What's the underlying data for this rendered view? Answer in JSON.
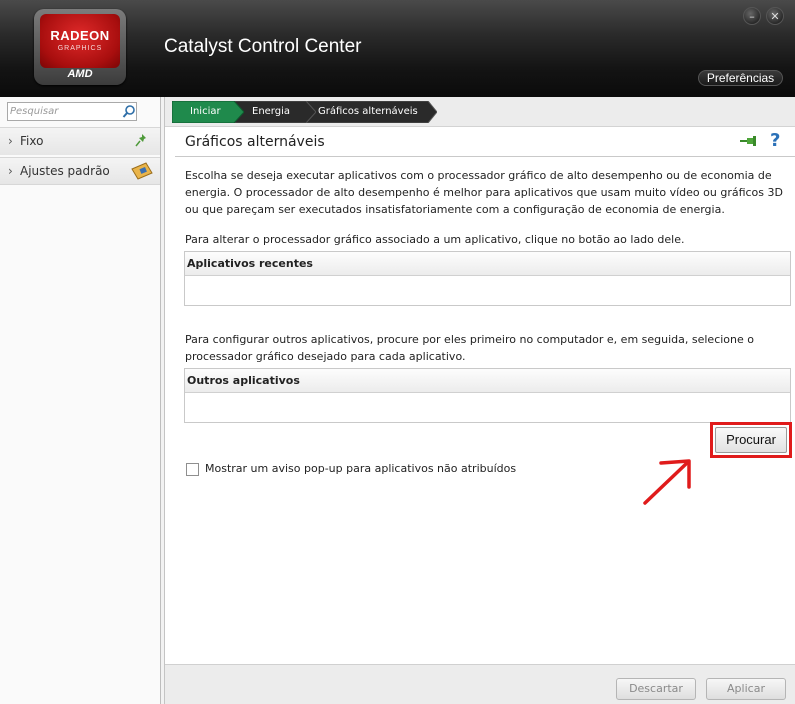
{
  "header": {
    "app_title": "Catalyst Control Center",
    "logo": {
      "line1": "RADEON",
      "line2": "GRAPHICS",
      "brand": "AMD"
    },
    "minimize_icon": "minus-icon",
    "close_icon": "close-icon",
    "minimize_glyph": "–",
    "close_glyph": "✕",
    "preferences_label": "Preferências"
  },
  "sidebar": {
    "search_placeholder": "Pesquisar",
    "search_icon": "search-icon",
    "items": [
      {
        "label": "Fixo",
        "icon": "pin-icon"
      },
      {
        "label": "Ajustes padrão",
        "icon": "card-icon"
      }
    ],
    "chevron": "›"
  },
  "breadcrumb": [
    "Iniciar",
    "Energia",
    "Gráficos alternáveis"
  ],
  "main": {
    "title": "Gráficos alternáveis",
    "help_glyph": "?",
    "description": "Escolha se deseja executar aplicativos com o processador gráfico de alto desempenho ou de economia de energia. O processador de alto desempenho é melhor para aplicativos que usam muito vídeo ou gráficos 3D ou que pareçam ser executados insatisfatoriamente com a configuração de economia de energia.",
    "hint": "Para alterar o processador gráfico associado a um aplicativo, clique no botão ao lado dele.",
    "recent_header": "Aplicativos recentes",
    "others_hint": "Para configurar outros aplicativos, procure por eles primeiro no computador e, em seguida, selecione o processador gráfico desejado para cada aplicativo.",
    "others_header": "Outros aplicativos",
    "browse_label": "Procurar",
    "popup_checkbox_label": "Mostrar um aviso pop-up para aplicativos não atribuídos",
    "popup_checkbox_checked": false
  },
  "footer": {
    "discard_label": "Descartar",
    "apply_label": "Aplicar"
  },
  "colors": {
    "breadcrumb_active": "#1f8a4c",
    "breadcrumb_inactive": "#2a2a2a",
    "highlight": "#e01b1b",
    "help": "#2b71b8"
  }
}
